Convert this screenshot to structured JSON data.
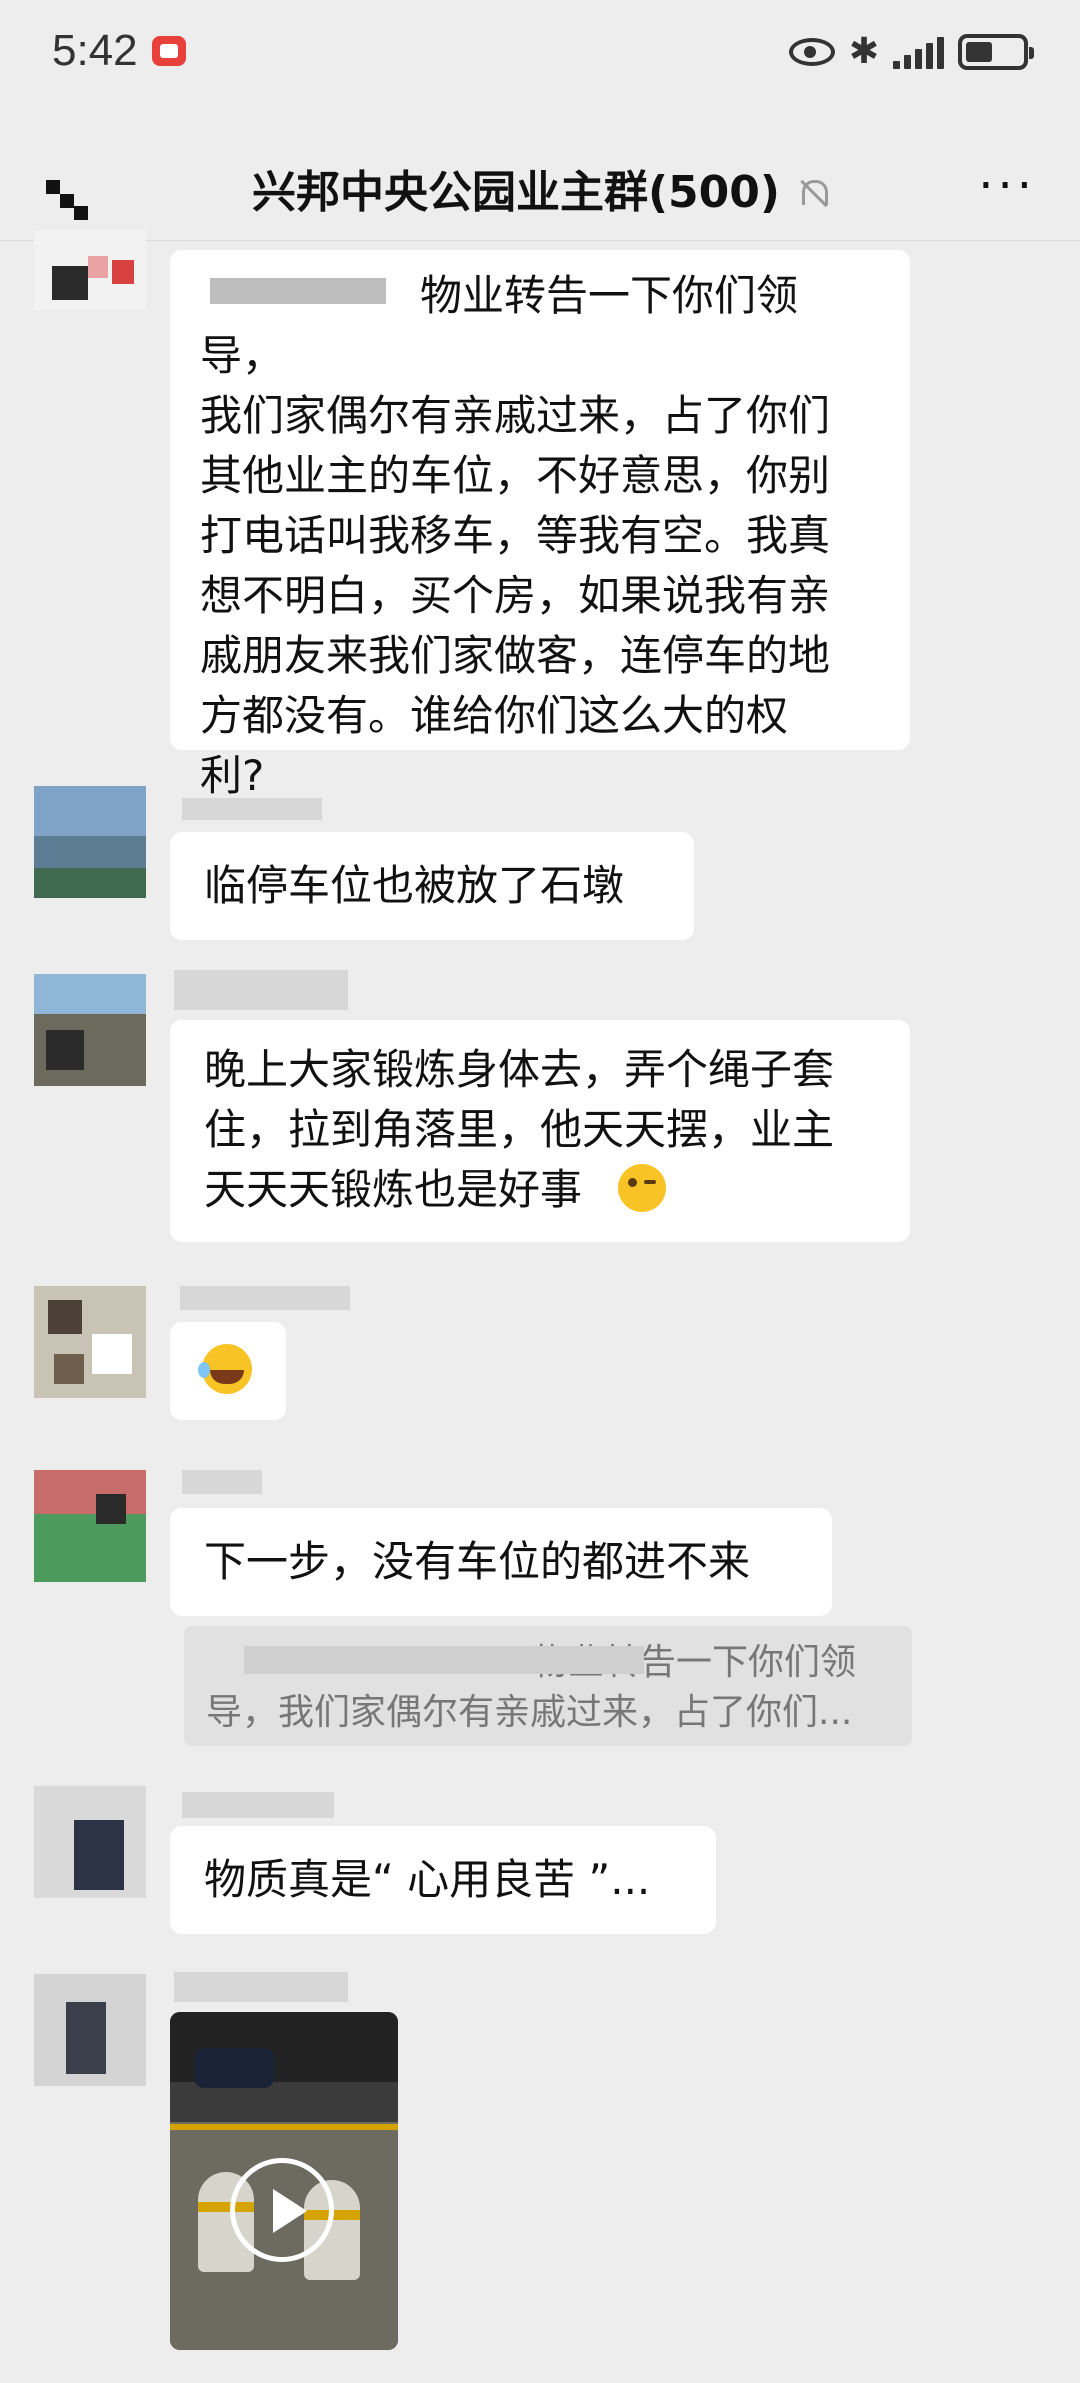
{
  "status_bar": {
    "time": "5:42"
  },
  "header": {
    "title": "兴邦中央公园业主群(500)"
  },
  "messages": [
    {
      "text": "物业转告一下你们领导，\n我们家偶尔有亲戚过来，占了你们\n其他业主的车位，不好意思，你别\n打电话叫我移车，等我有空。我真\n想不明白，买个房，如果说我有亲\n戚朋友来我们家做客，连停车的地\n方都没有。谁给你们这么大的权\n利?"
    },
    {
      "text": "临停车位也被放了石墩"
    },
    {
      "text": "晚上大家锻炼身体去，弄个绳子套\n住，拉到角落里，他天天摆，业主\n天天天锻炼也是好事"
    },
    {
      "emoji": "laughing-crying"
    },
    {
      "text": "下一步，没有车位的都进不来",
      "quote": "物业转告一下你们领\n导，我们家偶尔有亲戚过来，占了你们..."
    },
    {
      "text": "物质真是“ 心用良苦 ”..."
    },
    {
      "type": "video"
    }
  ]
}
